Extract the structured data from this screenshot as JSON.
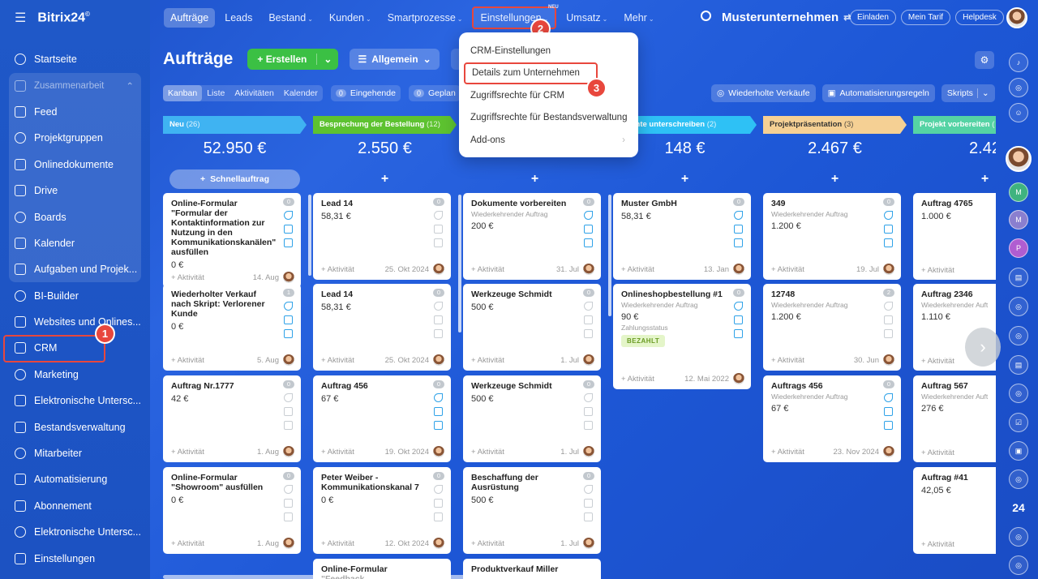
{
  "app": {
    "name": "Bitrix24",
    "mark": "©"
  },
  "sidebar": {
    "items": [
      {
        "label": "Startseite",
        "icon": "home-icon"
      },
      {
        "label": "Zusammenarbeit",
        "icon": "collab-icon",
        "group": true
      },
      {
        "label": "Feed",
        "icon": "feed-icon"
      },
      {
        "label": "Projektgruppen",
        "icon": "groups-icon"
      },
      {
        "label": "Onlinedokumente",
        "icon": "docs-icon"
      },
      {
        "label": "Drive",
        "icon": "drive-icon"
      },
      {
        "label": "Boards",
        "icon": "boards-icon"
      },
      {
        "label": "Kalender",
        "icon": "calendar-icon"
      },
      {
        "label": "Aufgaben und Projek...",
        "icon": "tasks-icon"
      },
      {
        "label": "BI-Builder",
        "icon": "bi-icon"
      },
      {
        "label": "Websites und Onlines...",
        "icon": "shop-icon"
      },
      {
        "label": "CRM",
        "icon": "crm-icon"
      },
      {
        "label": "Marketing",
        "icon": "marketing-icon"
      },
      {
        "label": "Elektronische Untersc...",
        "icon": "sign-icon"
      },
      {
        "label": "Bestandsverwaltung",
        "icon": "inventory-icon"
      },
      {
        "label": "Mitarbeiter",
        "icon": "employees-icon"
      },
      {
        "label": "Automatisierung",
        "icon": "automation-icon"
      },
      {
        "label": "Abonnement",
        "icon": "subscription-icon"
      },
      {
        "label": "Elektronische Untersc...",
        "icon": "sign2-icon"
      },
      {
        "label": "Einstellungen",
        "icon": "settings-icon"
      }
    ]
  },
  "topnav": {
    "items": [
      "Aufträge",
      "Leads",
      "Bestand",
      "Kunden",
      "Smartprozesse",
      "Einstellungen",
      "Umsatz",
      "Mehr"
    ],
    "new_tag": "NEU"
  },
  "company": "Musterunternehmen",
  "topbuttons": [
    "Einladen",
    "Mein Tarif",
    "Helpdesk"
  ],
  "badges": [
    "1",
    "2",
    "3"
  ],
  "header": {
    "title": "Aufträge",
    "create": "Erstellen",
    "pipeline": "Allgemein",
    "filter": "Filter"
  },
  "views": {
    "tabs": [
      "Kanban",
      "Liste",
      "Aktivitäten",
      "Kalender"
    ],
    "incoming": "Eingehende",
    "planned": "Geplan",
    "zero": "0"
  },
  "rightbuttons": [
    "Wiederholte Verkäufe",
    "Automatisierungsregeln",
    "Skripts"
  ],
  "dropdown": {
    "items": [
      "CRM-Einstellungen",
      "Details zum Unternehmen",
      "Zugriffsrechte für CRM",
      "Zugriffsrechte für Bestandsverwaltung",
      "Add-ons"
    ]
  },
  "quick_add": "Schnellauftrag",
  "common": {
    "add_activity": "+ Aktivität"
  },
  "columns": [
    {
      "name": "Neu",
      "count": "(26)",
      "sum": "52.950 €",
      "color": "#3fb3f2",
      "cards": [
        {
          "title": "Online-Formular \"Formular der Kontaktinformation zur Nutzung in den Kommunikationskanälen\" ausfüllen",
          "sub": "",
          "price": "0 €",
          "date": "14. Aug",
          "n": "0"
        },
        {
          "title": "Wiederholter Verkauf nach Skript: Verlorener Kunde",
          "sub": "",
          "price": "0 €",
          "date": "5. Aug",
          "n": "1"
        },
        {
          "title": "Auftrag Nr.1777",
          "sub": "",
          "price": "42 €",
          "date": "1. Aug",
          "n": "0"
        },
        {
          "title": "Online-Formular \"Showroom\" ausfüllen",
          "sub": "",
          "price": "0 €",
          "date": "1. Aug",
          "n": "0"
        }
      ]
    },
    {
      "name": "Besprechung der Bestellung",
      "count": "(12)",
      "sum": "2.550 €",
      "color": "#5dc230",
      "cards": [
        {
          "title": "Lead 14",
          "sub": "",
          "price": "58,31 €",
          "date": "25. Okt 2024",
          "n": "0"
        },
        {
          "title": "Lead 14",
          "sub": "",
          "price": "58,31 €",
          "date": "25. Okt 2024",
          "n": "0"
        },
        {
          "title": "Auftrag 456",
          "sub": "",
          "price": "67 €",
          "date": "19. Okt 2024",
          "n": "0"
        },
        {
          "title": "Peter Weiber - Kommunikationskanal 7",
          "sub": "",
          "price": "0 €",
          "date": "12. Okt 2024",
          "n": "0"
        },
        {
          "title": "Online-Formular \"Feedback",
          "sub": "",
          "price": "",
          "date": "",
          "n": "0"
        }
      ]
    },
    {
      "name": "",
      "count": "",
      "sum": "",
      "color": "#3fb3f2",
      "cards": [
        {
          "title": "Dokumente vorbereiten",
          "sub": "Wiederkehrender Auftrag",
          "price": "200 €",
          "date": "31. Jul",
          "n": "0"
        },
        {
          "title": "Werkzeuge Schmidt",
          "sub": "",
          "price": "500 €",
          "date": "1. Jul",
          "n": "0"
        },
        {
          "title": "Werkzeuge Schmidt",
          "sub": "",
          "price": "500 €",
          "date": "1. Jul",
          "n": "0"
        },
        {
          "title": "Beschaffung der Ausrüstung",
          "sub": "",
          "price": "500 €",
          "date": "1. Jul",
          "n": "0"
        },
        {
          "title": "Produktverkauf Miller",
          "sub": "",
          "price": "",
          "date": "",
          "n": "0"
        }
      ]
    },
    {
      "name": "umente unterschreiben",
      "count": "(2)",
      "sum": "148 €",
      "color": "#2ec1f5",
      "cards": [
        {
          "title": "Muster GmbH",
          "sub": "",
          "price": "58,31 €",
          "date": "13. Jan",
          "n": "0"
        },
        {
          "title": "Onlineshopbestellung #1",
          "sub": "Wiederkehrender Auftrag",
          "price": "90 €",
          "status_label": "Zahlungsstatus",
          "paid": "BEZAHLT",
          "date": "12. Mai 2022",
          "n": "0"
        }
      ]
    },
    {
      "name": "Projektpräsentation",
      "count": "(3)",
      "sum": "2.467 €",
      "color": "#f5d094",
      "cards": [
        {
          "title": "349",
          "sub": "Wiederkehrender Auftrag",
          "price": "1.200 €",
          "date": "19. Jul",
          "n": "0"
        },
        {
          "title": "12748",
          "sub": "Wiederkehrender Auftrag",
          "price": "1.200 €",
          "date": "30. Jun",
          "n": "2"
        },
        {
          "title": "Auftrags 456",
          "sub": "Wiederkehrender Auftrag",
          "price": "67 €",
          "date": "23. Nov 2024",
          "n": "0"
        }
      ]
    },
    {
      "name": "Projekt vorbereiten",
      "count": "(",
      "sum": "2.42",
      "color": "#55d3a4",
      "cards": [
        {
          "title": "Auftrag 4765",
          "sub": "",
          "price": "1.000 €",
          "date": "",
          "n": ""
        },
        {
          "title": "Auftrag 2346",
          "sub": "Wiederkehrender Auft",
          "price": "1.110 €",
          "date": "",
          "n": ""
        },
        {
          "title": "Auftrag 567",
          "sub": "Wiederkehrender Auft",
          "price": "276 €",
          "date": "",
          "n": ""
        },
        {
          "title": "Auftrag #41",
          "sub": "",
          "price": "42,05 €",
          "date": "24. A",
          "n": ""
        }
      ]
    }
  ]
}
